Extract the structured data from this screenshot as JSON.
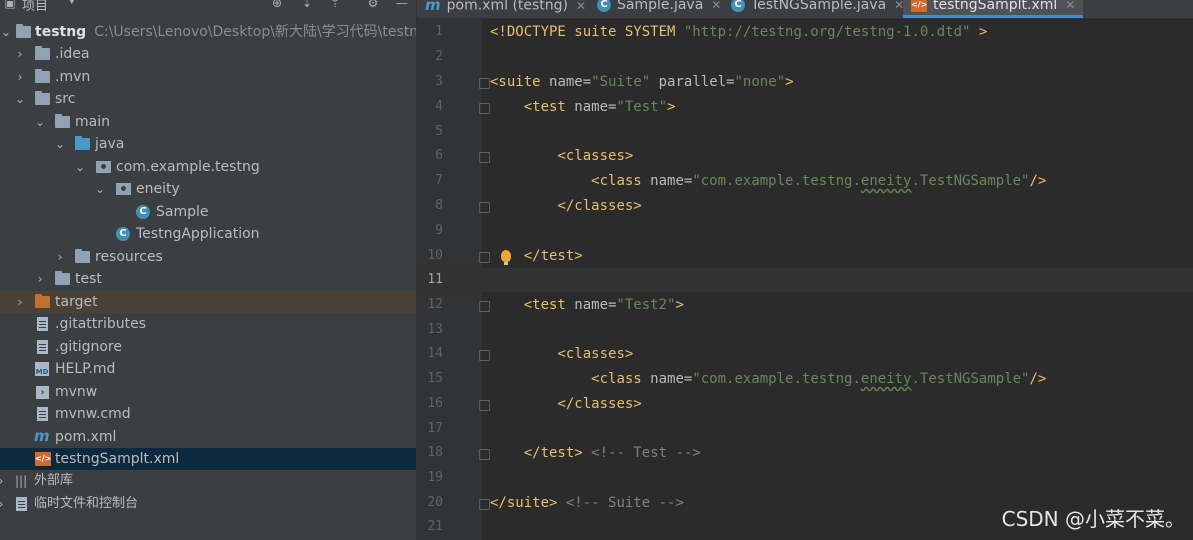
{
  "project_panel": {
    "title": "项目",
    "tree": [
      {
        "label": "testng",
        "path": "C:\\Users\\Lenovo\\Desktop\\新大陆\\学习代码\\testng"
      },
      {
        "label": ".idea"
      },
      {
        "label": ".mvn"
      },
      {
        "label": "src"
      },
      {
        "label": "main"
      },
      {
        "label": "java"
      },
      {
        "label": "com.example.testng"
      },
      {
        "label": "eneity"
      },
      {
        "label": "Sample"
      },
      {
        "label": "TestngApplication"
      },
      {
        "label": "resources"
      },
      {
        "label": "test"
      },
      {
        "label": "target"
      },
      {
        "label": ".gitattributes"
      },
      {
        "label": ".gitignore"
      },
      {
        "label": "HELP.md"
      },
      {
        "label": "mvnw"
      },
      {
        "label": "mvnw.cmd"
      },
      {
        "label": "pom.xml"
      },
      {
        "label": "testngSamplt.xml"
      },
      {
        "label": "外部库"
      },
      {
        "label": "临时文件和控制台"
      }
    ]
  },
  "tabs": [
    {
      "label": "pom.xml (testng)",
      "icon": "maven-icon"
    },
    {
      "label": "Sample.java",
      "icon": "class-icon"
    },
    {
      "label": "TestNGSample.java",
      "icon": "class-icon"
    },
    {
      "label": "testngSamplt.xml",
      "icon": "xml-icon",
      "active": true
    }
  ],
  "editor": {
    "lines": [
      "1",
      "2",
      "3",
      "4",
      "5",
      "6",
      "7",
      "8",
      "9",
      "10",
      "11",
      "12",
      "13",
      "14",
      "15",
      "16",
      "17",
      "18",
      "19",
      "20",
      "21"
    ],
    "current_line": "11",
    "code": {
      "doctype": "<!DOCTYPE suite SYSTEM ",
      "doctype_url": "\"http://testng.org/testng-1.0.dtd\"",
      "doctype_end": " >",
      "suite_open": "<suite ",
      "name_attr": "name=",
      "suite_name": "\"Suite\"",
      "parallel_attr": " parallel=",
      "parallel_val": "\"none\"",
      "gt": ">",
      "test_open": "<test ",
      "test1_name": "\"Test\"",
      "test2_name": "\"Test2\"",
      "classes_open": "<classes>",
      "class_open": "<class ",
      "class_val_pre": "\"com.example.testng.",
      "class_val_typo": "eneity",
      "class_val_post": ".TestNGSample\"",
      "self_close": "/>",
      "classes_close": "</classes>",
      "test_close": "</test>",
      "test_comment": " <!-- Test -->",
      "suite_close": "</suite>",
      "suite_comment": " <!-- Suite -->"
    }
  },
  "watermark": "CSDN @小菜不菜。"
}
